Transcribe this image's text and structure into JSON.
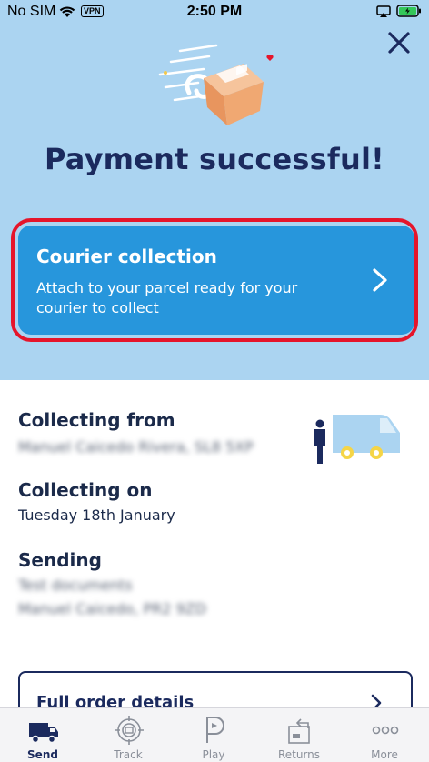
{
  "status_bar": {
    "carrier": "No SIM",
    "vpn": "VPN",
    "time": "2:50 PM"
  },
  "header": {
    "title": "Payment successful!"
  },
  "courier_card": {
    "title": "Courier collection",
    "description": "Attach to your parcel ready for your courier to collect"
  },
  "details": {
    "collecting_from_label": "Collecting from",
    "collecting_from_value": "Manuel Caicedo Rivera, SL8 5XP",
    "collecting_on_label": "Collecting on",
    "collecting_on_value": "Tuesday 18th January",
    "sending_label": "Sending",
    "sending_line1": "Test documents",
    "sending_line2": "Manuel Caicedo, PR2 9ZD"
  },
  "order_button": {
    "label": "Full order details"
  },
  "tabs": [
    {
      "label": "Send",
      "icon": "van-icon",
      "active": true
    },
    {
      "label": "Track",
      "icon": "track-icon",
      "active": false
    },
    {
      "label": "Play",
      "icon": "play-icon",
      "active": false
    },
    {
      "label": "Returns",
      "icon": "returns-icon",
      "active": false
    },
    {
      "label": "More",
      "icon": "more-icon",
      "active": false
    }
  ],
  "colors": {
    "header_bg": "#abd4f1",
    "card_blue": "#2796dc",
    "highlight_red": "#e5152b",
    "navy": "#1b2a5e"
  }
}
